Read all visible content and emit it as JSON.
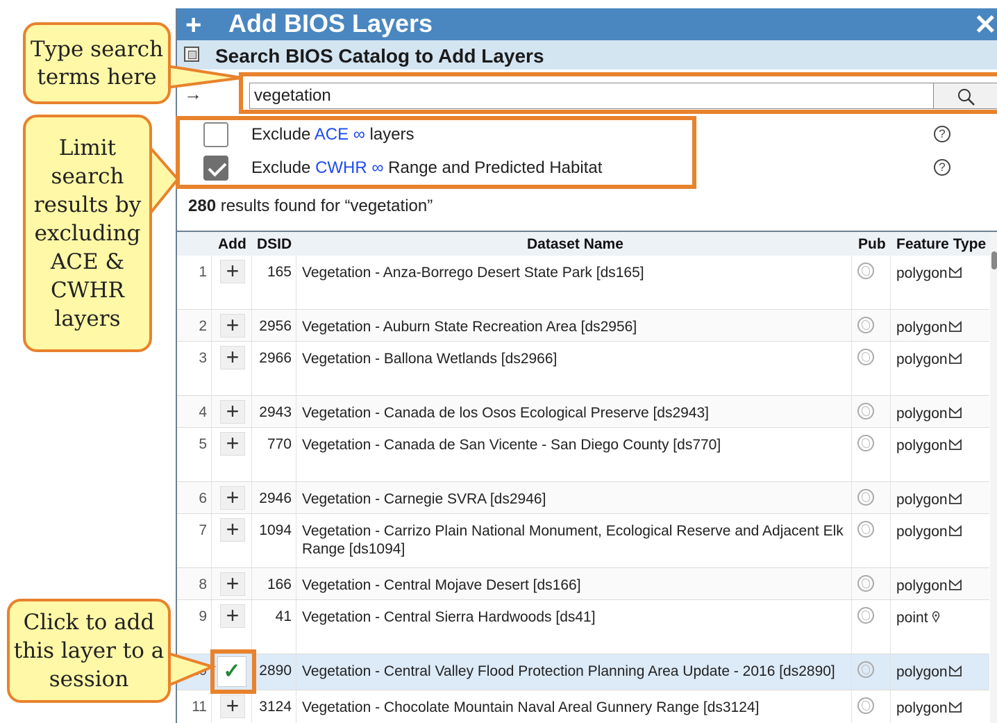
{
  "panel": {
    "title_icon": "plus-icon",
    "title": "Add BIOS Layers",
    "close_icon": "close-x-icon",
    "subtitle_icon": "catalog-icon",
    "subtitle": "Search BIOS Catalog to Add Layers"
  },
  "search": {
    "arrow": "→",
    "value": "vegetation",
    "button_icon": "magnifier-icon"
  },
  "filters": [
    {
      "prefix": "Exclude ",
      "link": "ACE ∞",
      "suffix": " layers",
      "checked": false,
      "help": "?"
    },
    {
      "prefix": "Exclude ",
      "link": "CWHR ∞",
      "suffix": " Range and Predicted Habitat",
      "checked": true,
      "help": "?"
    }
  ],
  "results": {
    "count": "280",
    "text": " results found for “vegetation”"
  },
  "table": {
    "headers": {
      "add": "Add",
      "dsid": "DSID",
      "name": "Dataset Name",
      "pub": "Pub",
      "ftype": "Feature Type"
    },
    "rows": [
      {
        "num": "1",
        "dsid": "165",
        "name": "Vegetation - Anza-Borrego Desert State Park [ds165]",
        "ftype": "polygon",
        "added": false
      },
      {
        "num": "2",
        "dsid": "2956",
        "name": "Vegetation - Auburn State Recreation Area [ds2956]",
        "ftype": "polygon",
        "added": false
      },
      {
        "num": "3",
        "dsid": "2966",
        "name": "Vegetation - Ballona Wetlands [ds2966]",
        "ftype": "polygon",
        "added": false
      },
      {
        "num": "4",
        "dsid": "2943",
        "name": "Vegetation - Canada de los Osos Ecological Preserve [ds2943]",
        "ftype": "polygon",
        "added": false
      },
      {
        "num": "5",
        "dsid": "770",
        "name": "Vegetation - Canada de San Vicente - San Diego County [ds770]",
        "ftype": "polygon",
        "added": false
      },
      {
        "num": "6",
        "dsid": "2946",
        "name": "Vegetation - Carnegie SVRA [ds2946]",
        "ftype": "polygon",
        "added": false
      },
      {
        "num": "7",
        "dsid": "1094",
        "name": "Vegetation - Carrizo Plain National Monument, Ecological Reserve and Adjacent Elk Range [ds1094]",
        "ftype": "polygon",
        "added": false
      },
      {
        "num": "8",
        "dsid": "166",
        "name": "Vegetation - Central Mojave Desert [ds166]",
        "ftype": "polygon",
        "added": false
      },
      {
        "num": "9",
        "dsid": "41",
        "name": "Vegetation - Central Sierra Hardwoods [ds41]",
        "ftype": "point",
        "added": false
      },
      {
        "num": "10",
        "dsid": "2890",
        "name": "Vegetation - Central Valley Flood Protection Planning Area Update - 2016 [ds2890]",
        "ftype": "polygon",
        "added": true
      },
      {
        "num": "11",
        "dsid": "3124",
        "name": "Vegetation - Chocolate Mountain Naval Areal Gunnery Range [ds3124]",
        "ftype": "polygon",
        "added": false
      }
    ],
    "add_symbol": "+",
    "added_symbol": "✓"
  },
  "callouts": [
    {
      "lines": [
        "Type search",
        "terms here"
      ]
    },
    {
      "lines": [
        "Limit",
        "search",
        "results by",
        "excluding",
        "ACE &",
        "CWHR",
        "layers"
      ]
    },
    {
      "lines": [
        "Click to add",
        "this layer to a",
        "session"
      ]
    }
  ],
  "colors": {
    "title_bar": "#4a87c0",
    "subtitle_bar": "#d4e5f2",
    "highlight": "#e8822c",
    "callout_fill": "#fff8a6",
    "link": "#1f4cf0",
    "added_check": "#1e8a2e",
    "selected_row": "#ddeaf7"
  }
}
